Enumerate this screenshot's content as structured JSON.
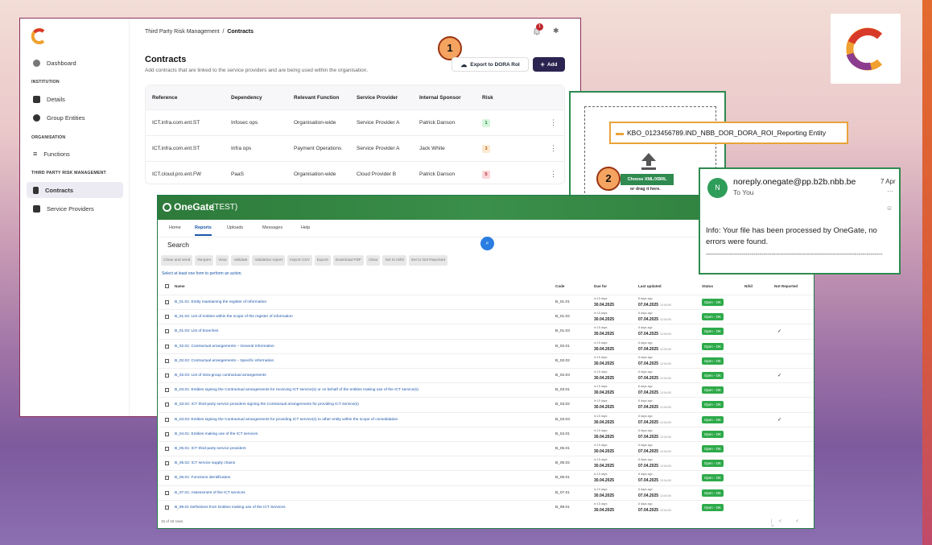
{
  "colors": {
    "brand_navy": "#2c2450",
    "onegate_green": "#2f8a50",
    "callout_orange": "#f4a460",
    "status_ok": "#2eaa4a"
  },
  "sidebar": {
    "items": [
      {
        "label": "Dashboard",
        "icon": "dashboard-icon"
      },
      {
        "label": "Details",
        "icon": "bank-icon"
      },
      {
        "label": "Group Entities",
        "icon": "pie-icon"
      },
      {
        "label": "Functions",
        "icon": "list-icon"
      },
      {
        "label": "Contracts",
        "icon": "document-icon"
      },
      {
        "label": "Service Providers",
        "icon": "building-icon"
      }
    ],
    "sections": [
      "INSTITUTION",
      "ORGANISATION",
      "THIRD PARTY RISK MANAGEMENT"
    ]
  },
  "header": {
    "breadcrumb_root": "Third Party Risk Management",
    "breadcrumb_sep": "/",
    "breadcrumb_current": "Contracts",
    "notification_count": "1"
  },
  "main": {
    "title": "Contracts",
    "subtitle": "Add contracts that are linked to the service providers and are being used within the organisation.",
    "export_label": "Export to DORA RoI",
    "add_label": "Add",
    "callout_1": "1",
    "columns": [
      "Reference",
      "Dependency",
      "Relevant Function",
      "Service Provider",
      "Internal Sponsor",
      "Risk"
    ],
    "rows": [
      {
        "reference": "ICT.infra.com.ent.ST",
        "dependency": "Infosec ops",
        "function": "Organisation-wide",
        "provider": "Service Provider A",
        "sponsor": "Patrick Danson",
        "risk": "1"
      },
      {
        "reference": "ICT.infra.com.ent.ST",
        "dependency": "Infra ops",
        "function": "Payment Operations",
        "provider": "Service Provider A",
        "sponsor": "Jack White",
        "risk": "3"
      },
      {
        "reference": "ICT.cloud.pro.ent.FW",
        "dependency": "PaaS",
        "function": "Organisation-wide",
        "provider": "Cloud Provider B",
        "sponsor": "Patrick Danson",
        "risk": "5"
      }
    ]
  },
  "onegate": {
    "logo": "OneGate",
    "env": "(TEST)",
    "tabs": [
      "Home",
      "Reports",
      "Uploads",
      "Messages",
      "Help"
    ],
    "search_label": "Search",
    "toolbar": [
      "Close and send",
      "Reopen",
      "View",
      "Validate",
      "Validation report",
      "Import CSV",
      "Export",
      "Download PDF",
      "Clear",
      "Set to Nihil",
      "Set to Not Reported"
    ],
    "hint": "Select at least one form to perform an action.",
    "columns": [
      "Name",
      "Code",
      "Due for",
      "Last updated",
      "Status",
      "Nihil",
      "Not Reported"
    ],
    "due_rel": "in 15 days",
    "due_date": "30.04.2025",
    "upd_rel": "8 days ago",
    "upd_date": "07.04.2025",
    "upd_time": "12:04:00",
    "status": "Open - OK",
    "rows": [
      {
        "name": "B_01.01: Entity maintaining the register of information",
        "code": "B_01.01",
        "nr": ""
      },
      {
        "name": "B_01.02: List of entities within the scope of the register of information",
        "code": "B_01.02",
        "nr": ""
      },
      {
        "name": "B_01.03: List of branches",
        "code": "B_01.03",
        "nr": "✓"
      },
      {
        "name": "B_02.01: Contractual arrangements – General Information",
        "code": "B_02.01",
        "nr": ""
      },
      {
        "name": "B_02.02: Contractual arrangements – Specific information",
        "code": "B_02.02",
        "nr": ""
      },
      {
        "name": "B_02.03: List of intra-group contractual arrangements",
        "code": "B_02.03",
        "nr": "✓"
      },
      {
        "name": "B_03.01: Entities signing the Contractual arrangements for receiving ICT service(s) or on behalf of the entities making use of the ICT service(s)",
        "code": "B_03.01",
        "nr": ""
      },
      {
        "name": "B_03.02: ICT third-party service providers signing the Contractual arrangements for providing ICT service(s)",
        "code": "B_03.02",
        "nr": ""
      },
      {
        "name": "B_03.03: Entities signing the Contractual arrangements for providing ICT service(s) to other entity within the scope of consolidation",
        "code": "B_03.03",
        "nr": "✓"
      },
      {
        "name": "B_04.01: Entities making use of the ICT services",
        "code": "B_04.01",
        "nr": ""
      },
      {
        "name": "B_05.01: ICT third-party service providers",
        "code": "B_05.01",
        "nr": ""
      },
      {
        "name": "B_05.02: ICT service supply chains",
        "code": "B_05.02",
        "nr": ""
      },
      {
        "name": "B_06.01: Functions identification",
        "code": "B_06.01",
        "nr": ""
      },
      {
        "name": "B_07.01: Assessment of the ICT services",
        "code": "B_07.01",
        "nr": ""
      },
      {
        "name": "B_99.01 Definitions from Entities making use of the ICT Services",
        "code": "B_99.01",
        "nr": ""
      }
    ],
    "footer": "15 of 15 rows.",
    "pager": "|< < >"
  },
  "upload": {
    "file_name": "KBO_0123456789.IND_NBB_DOR_DORA_ROI_Reporting Entity",
    "button": "Choose XML/XBRL",
    "drag": "or drag it here.",
    "callout_2": "2"
  },
  "email": {
    "avatar": "N",
    "from": "noreply.onegate@pp.b2b.nbb.be",
    "to": "To You",
    "date": "7 Apr",
    "body": "Info: Your file has been processed by OneGate, no errors were found.",
    "dashes": "-----------------------------------------------------------------------------------------"
  }
}
